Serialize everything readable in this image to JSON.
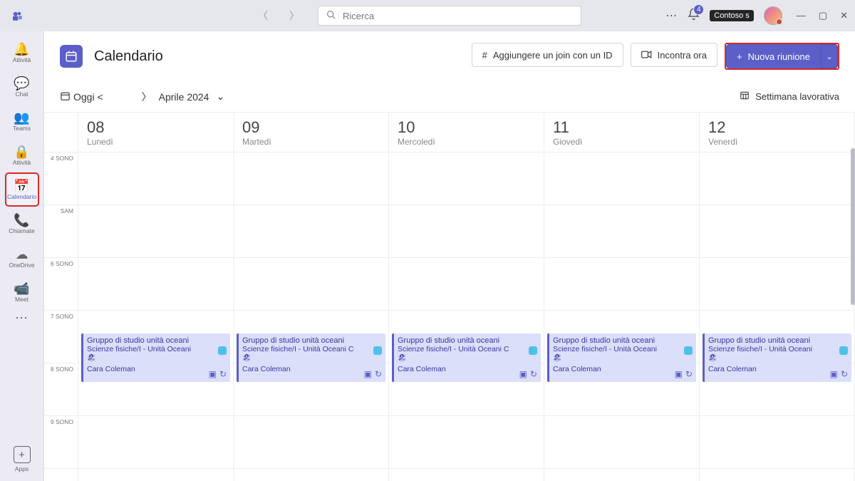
{
  "search": {
    "placeholder": "Ricerca"
  },
  "notifications": {
    "count": "4"
  },
  "tenant": {
    "label": "Contoso s"
  },
  "rail": {
    "items": [
      {
        "icon": "🔔",
        "label": "Attività",
        "name": "rail-activity"
      },
      {
        "icon": "💬",
        "label": "Chat",
        "name": "rail-chat"
      },
      {
        "icon": "👥",
        "label": "Teams",
        "name": "rail-teams"
      },
      {
        "icon": "🔒",
        "label": "Attività",
        "name": "rail-assignments"
      },
      {
        "icon": "📅",
        "label": "Calendario",
        "name": "rail-calendar",
        "selected": true
      },
      {
        "icon": "📞",
        "label": "Chiamate",
        "name": "rail-calls"
      },
      {
        "icon": "☁",
        "label": "OneDrive",
        "name": "rail-onedrive"
      },
      {
        "icon": "📹",
        "label": "Meet",
        "name": "rail-meet"
      }
    ],
    "apps_label": "Apps"
  },
  "header": {
    "title": "Calendario",
    "join_id": "Aggiungere un join con un ID",
    "meet_now": "Incontra ora",
    "new_meeting": "Nuova riunione"
  },
  "toolbar": {
    "today": "Oggi <",
    "month": "Aprile 2024",
    "view": "Settimana lavorativa"
  },
  "time_labels": [
    "4 SONO",
    "SAM",
    "6 SONO",
    "7 SONO",
    "8 SONO",
    "9 SONO"
  ],
  "days": [
    {
      "num": "08",
      "name": "Lunedì"
    },
    {
      "num": "09",
      "name": "Martedì"
    },
    {
      "num": "10",
      "name": "Mercoledì"
    },
    {
      "num": "11",
      "name": "Giovedì"
    },
    {
      "num": "12",
      "name": "Venerdì"
    }
  ],
  "events": [
    {
      "title": "Gruppo di studio unità oceani",
      "sub": "Scienze fisiche/I - Unità Oceani",
      "organizer": "Cara Coleman"
    },
    {
      "title": "Gruppo di studio unità oceani",
      "sub": "Scienze fisiche/I - Unità Oceani C",
      "organizer": "Cara Coleman"
    },
    {
      "title": "Gruppo di studio unità oceani",
      "sub": "Scienze fisiche/I - Unità Oceani C",
      "organizer": "Cara Coleman"
    },
    {
      "title": "Gruppo di studio unità oceani",
      "sub": "Scienze fisiche/I - Unità Oceani",
      "organizer": "Cara Coleman"
    },
    {
      "title": "Gruppo di studio unità oceani",
      "sub": "Scienze fisiche/I - Unità Oceani",
      "organizer": "Cara Coleman"
    }
  ]
}
